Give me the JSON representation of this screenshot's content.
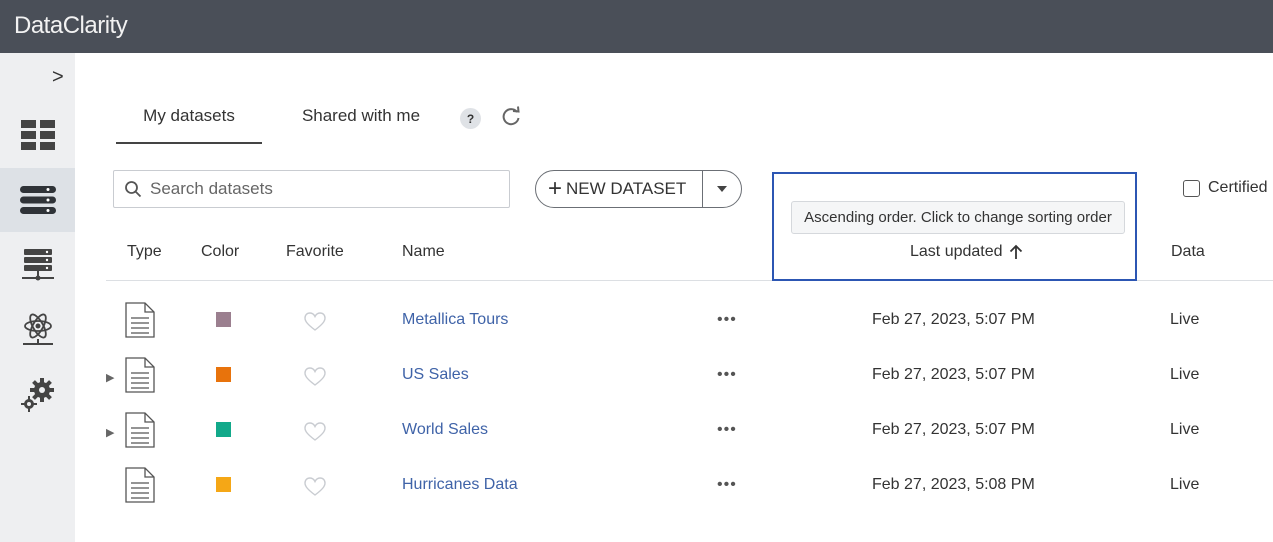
{
  "app": {
    "title": "DataClarity"
  },
  "sidebar": {
    "toggle": ">",
    "items": [
      {
        "name": "dashboards",
        "icon": "dashboard-icon",
        "active": false
      },
      {
        "name": "datasets",
        "icon": "datasets-icon",
        "active": true
      },
      {
        "name": "data-servers",
        "icon": "server-icon",
        "active": false
      },
      {
        "name": "models",
        "icon": "atom-icon",
        "active": false
      },
      {
        "name": "settings",
        "icon": "gears-icon",
        "active": false
      }
    ]
  },
  "tabs": [
    {
      "label": "My datasets",
      "active": true
    },
    {
      "label": "Shared with me",
      "active": false
    }
  ],
  "help_label": "?",
  "search": {
    "placeholder": "Search datasets",
    "value": ""
  },
  "new_dataset": {
    "label": "NEW DATASET"
  },
  "certified": {
    "label": "Certified",
    "checked": false
  },
  "tooltip": "Ascending order. Click to change sorting order",
  "columns": {
    "type": "Type",
    "color": "Color",
    "favorite": "Favorite",
    "name": "Name",
    "last_updated": "Last updated",
    "data": "Data"
  },
  "rows": [
    {
      "name": "Metallica Tours",
      "color": "#9b7f8f",
      "expandable": false,
      "updated": "Feb 27, 2023, 5:07 PM",
      "data": "Live"
    },
    {
      "name": "US Sales",
      "color": "#e8730c",
      "expandable": true,
      "updated": "Feb 27, 2023, 5:07 PM",
      "data": "Live"
    },
    {
      "name": "World Sales",
      "color": "#12a98a",
      "expandable": true,
      "updated": "Feb 27, 2023, 5:07 PM",
      "data": "Live"
    },
    {
      "name": "Hurricanes Data",
      "color": "#f5a716",
      "expandable": false,
      "updated": "Feb 27, 2023, 5:08 PM",
      "data": "Live"
    }
  ],
  "more_label": "•••",
  "colors": {
    "topbar": "#4a4f58",
    "highlight": "#2c56b3",
    "link": "#3f63a8"
  }
}
